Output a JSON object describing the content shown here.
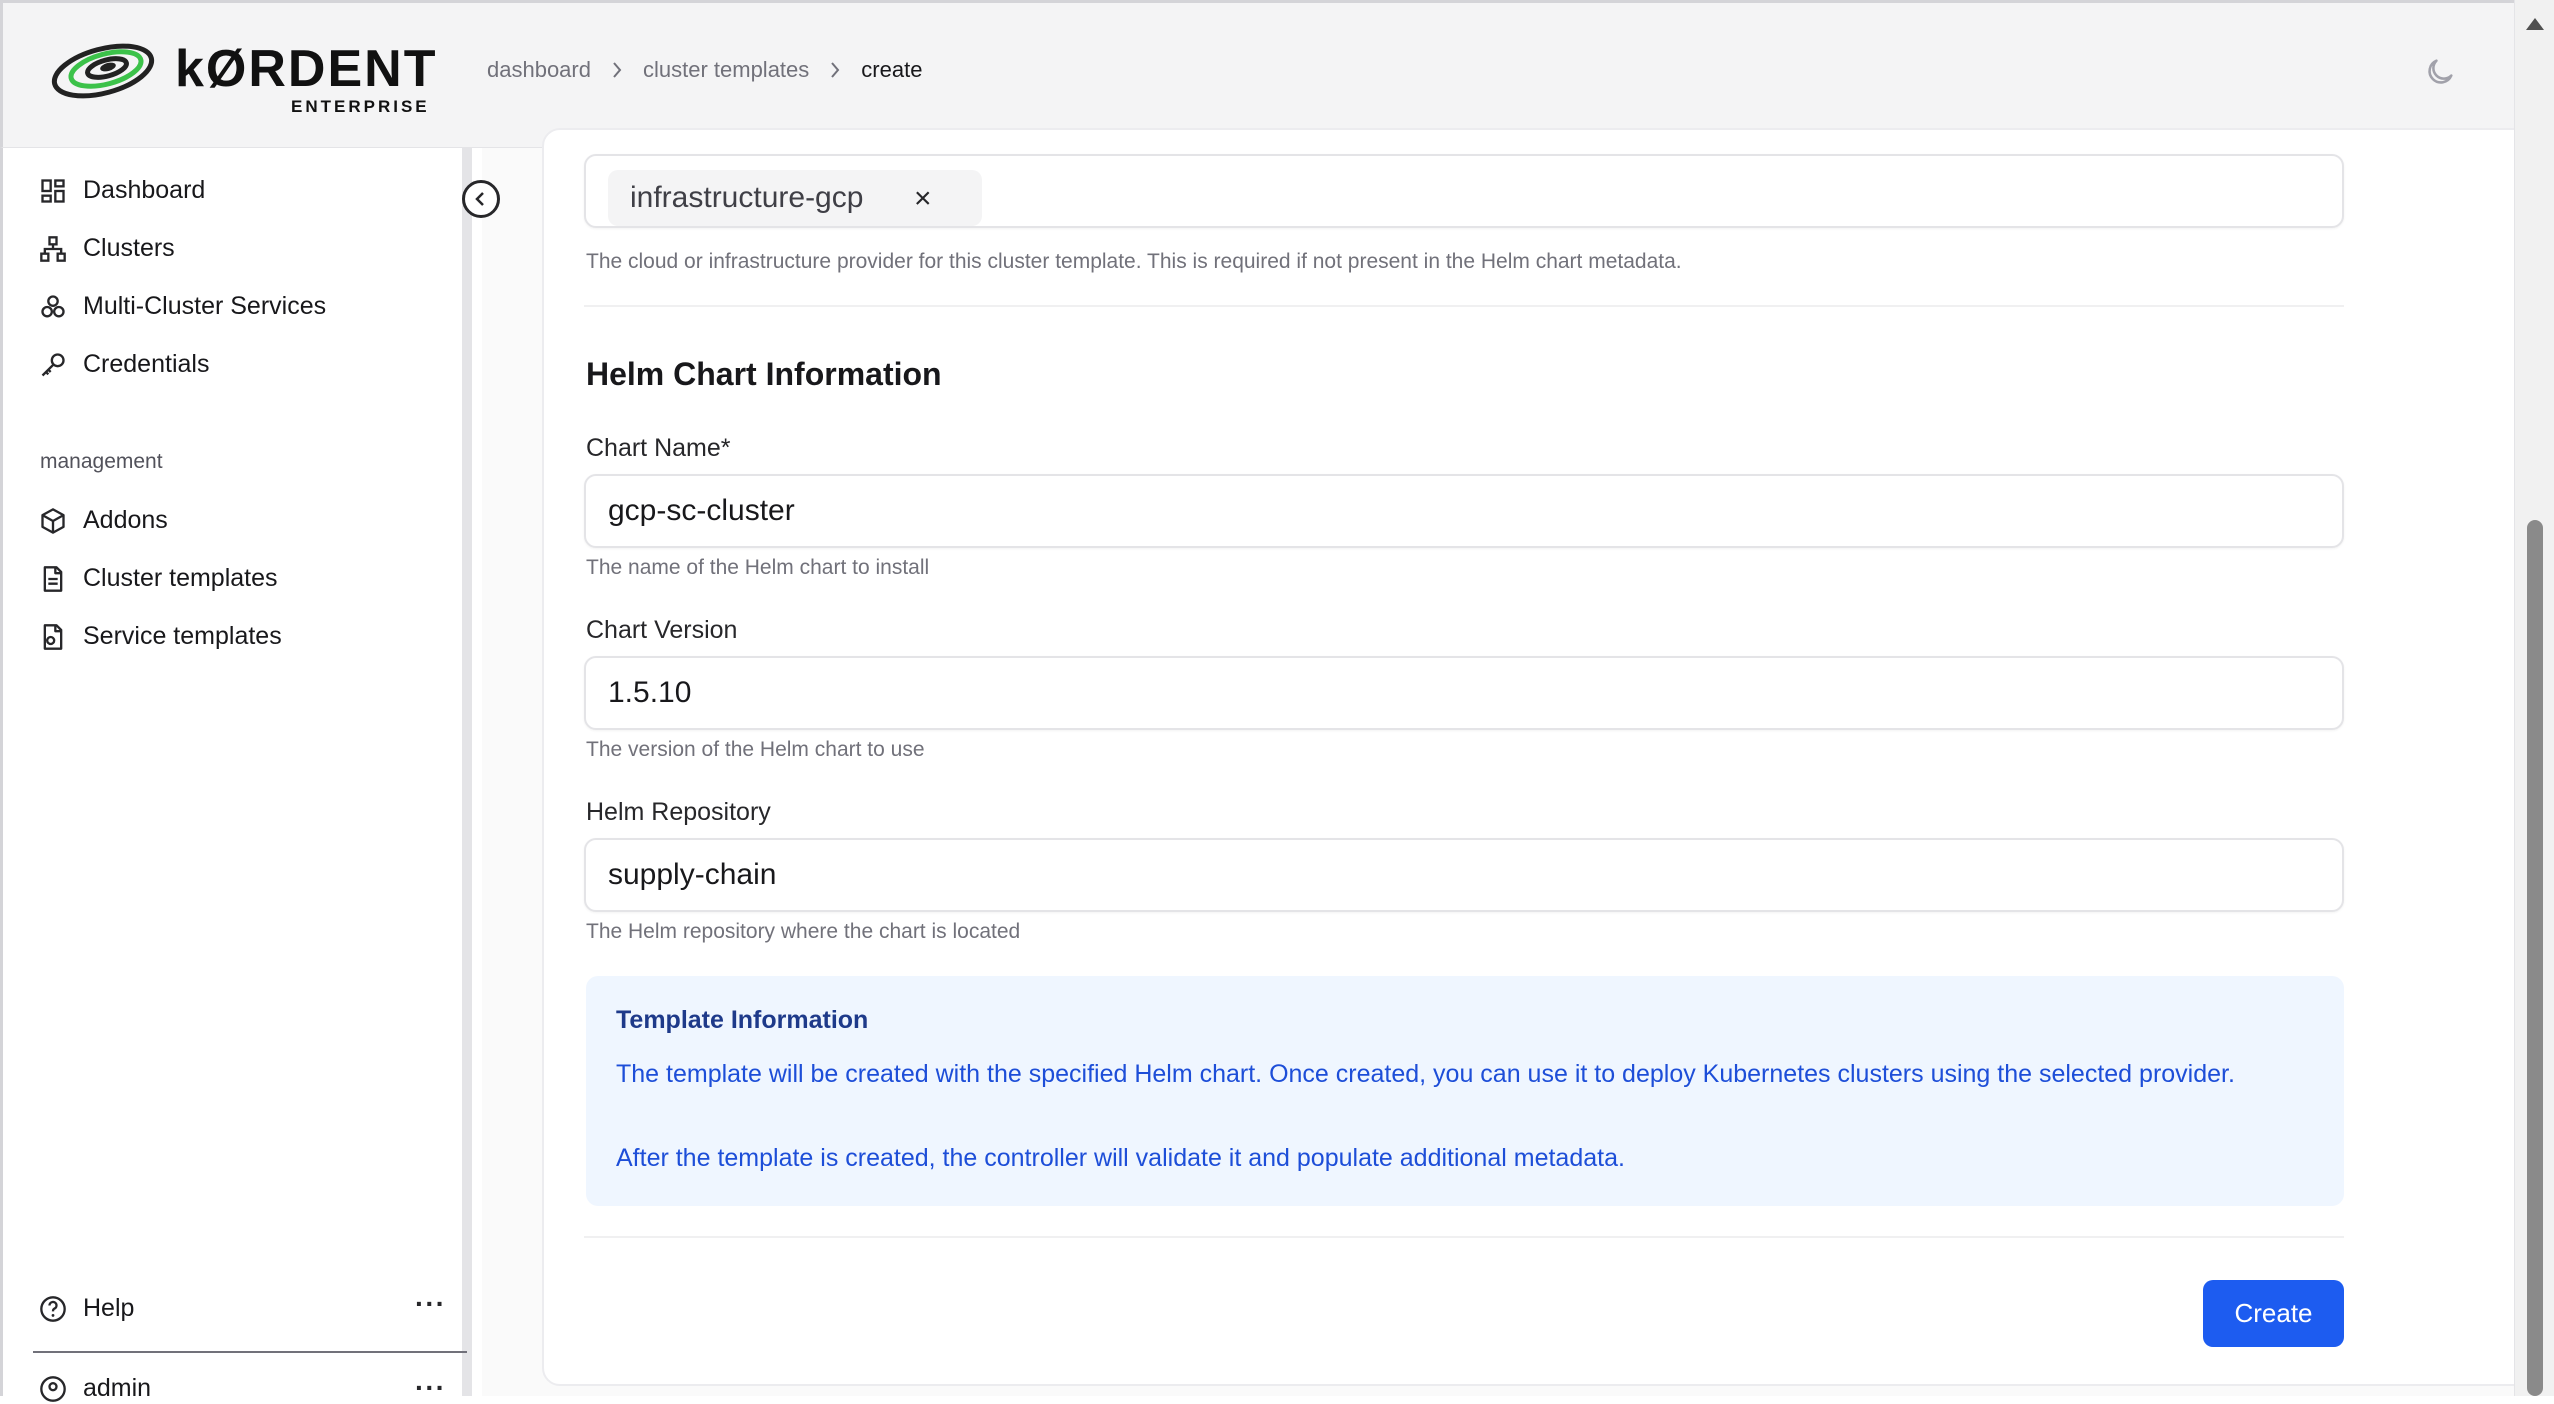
{
  "brand": {
    "name": "kØRDENT",
    "sub": "ENTERPRISE"
  },
  "breadcrumb": {
    "items": [
      "dashboard",
      "cluster templates"
    ],
    "current": "create"
  },
  "sidebar": {
    "items": [
      {
        "label": "Dashboard",
        "icon": "dashboard-icon"
      },
      {
        "label": "Clusters",
        "icon": "clusters-icon"
      },
      {
        "label": "Multi-Cluster Services",
        "icon": "multi-cluster-icon"
      },
      {
        "label": "Credentials",
        "icon": "key-icon"
      }
    ],
    "section_label": "management",
    "management_items": [
      {
        "label": "Addons",
        "icon": "box-icon"
      },
      {
        "label": "Cluster templates",
        "icon": "file-icon"
      },
      {
        "label": "Service templates",
        "icon": "file-gear-icon"
      }
    ],
    "help_label": "Help",
    "user_label": "admin",
    "more_label": "···"
  },
  "form": {
    "provider_chip": "infrastructure-gcp",
    "provider_remove": "×",
    "provider_help": "The cloud or infrastructure provider for this cluster template. This is required if not present in the Helm chart metadata.",
    "section_title": "Helm Chart Information",
    "chart_name": {
      "label": "Chart Name*",
      "value": "gcp-sc-cluster",
      "help": "The name of the Helm chart to install"
    },
    "chart_version": {
      "label": "Chart Version",
      "value": "1.5.10",
      "help": "The version of the Helm chart to use"
    },
    "helm_repo": {
      "label": "Helm Repository",
      "value": "supply-chain",
      "help": "The Helm repository where the chart is located"
    },
    "info": {
      "title": "Template Information",
      "p1": "The template will be created with the specified Helm chart. Once created, you can use it to deploy Kubernetes clusters using the selected provider.",
      "p2": "After the template is created, the controller will validate it and populate additional metadata."
    },
    "submit_label": "Create"
  },
  "colors": {
    "primary": "#1d5cf0",
    "info_bg": "#eff6ff",
    "info_text": "#1d4ed8",
    "logo_green": "#3cc24a"
  }
}
